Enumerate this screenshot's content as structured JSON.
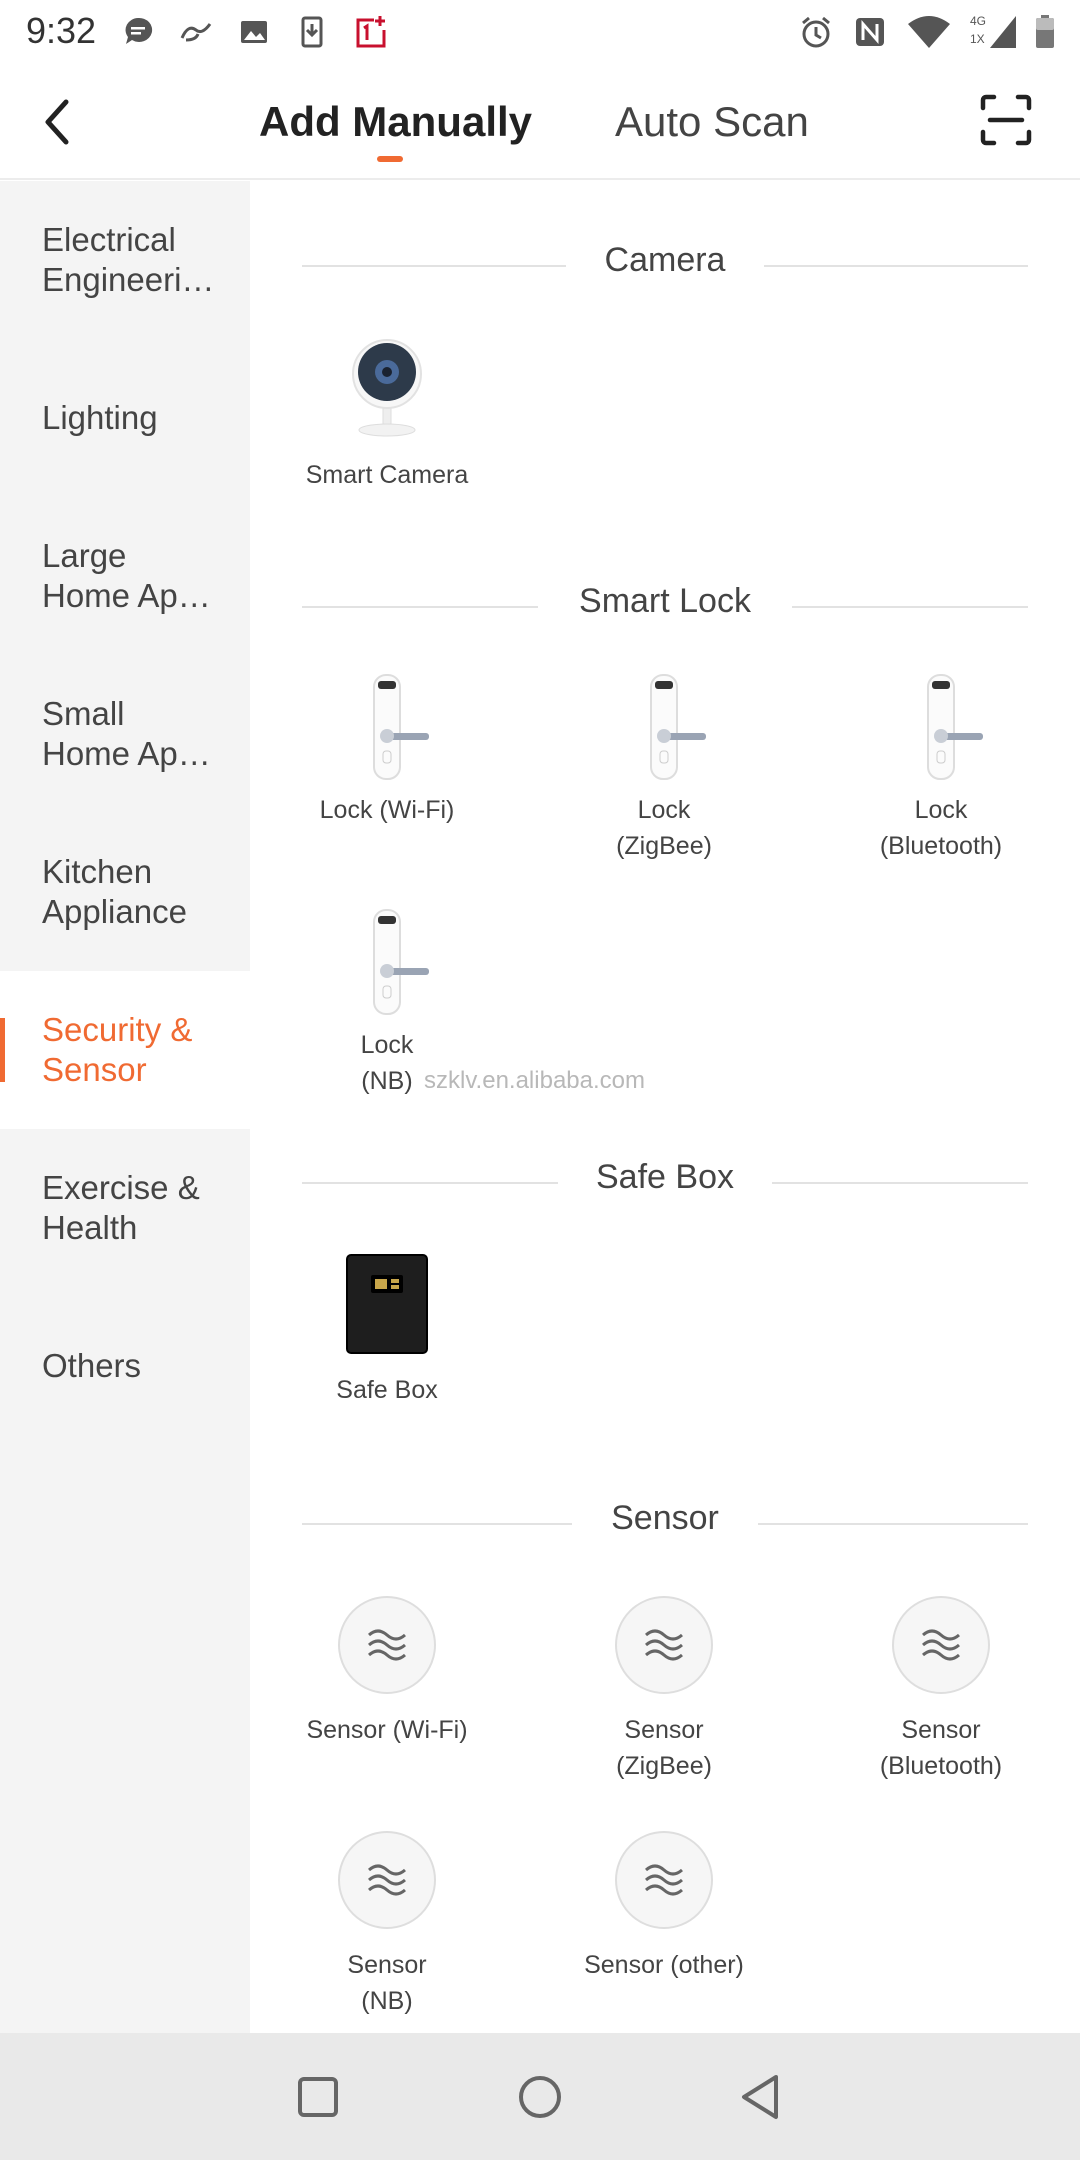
{
  "status_bar": {
    "time": "9:32",
    "left_icons": [
      "chat-icon",
      "alibaba-icon",
      "image-icon",
      "download-icon",
      "oneplus-icon"
    ],
    "right_icons": [
      "alarm-icon",
      "nfc-icon",
      "wifi-icon",
      "signal-icon",
      "battery-icon"
    ],
    "network_label": "4G",
    "network_sub": "1X"
  },
  "header": {
    "back_icon": "chevron-left-icon",
    "tabs": [
      {
        "label": "Add Manually",
        "active": true
      },
      {
        "label": "Auto Scan",
        "active": false
      }
    ],
    "scan_icon": "scan-icon",
    "accent_color": "#f06a32"
  },
  "sidebar": {
    "items": [
      {
        "label": "Electrical\nEngineeri…",
        "active": false
      },
      {
        "label": "Lighting",
        "active": false
      },
      {
        "label": "Large\nHome Ap…",
        "active": false
      },
      {
        "label": "Small\nHome Ap…",
        "active": false
      },
      {
        "label": "Kitchen\nAppliance",
        "active": false
      },
      {
        "label": "Security &\nSensor",
        "active": true
      },
      {
        "label": "Exercise &\nHealth",
        "active": false
      },
      {
        "label": "Others",
        "active": false
      }
    ]
  },
  "sections": [
    {
      "title": "Camera",
      "devices": [
        {
          "label": "Smart Camera",
          "icon": "camera-icon"
        }
      ]
    },
    {
      "title": "Smart Lock",
      "devices": [
        {
          "label": "Lock (Wi-Fi)",
          "icon": "lock-icon"
        },
        {
          "label": "Lock\n(ZigBee)",
          "icon": "lock-icon"
        },
        {
          "label": "Lock\n(Bluetooth)",
          "icon": "lock-icon"
        },
        {
          "label": "Lock\n(NB)",
          "icon": "lock-icon"
        }
      ]
    },
    {
      "title": "Safe Box",
      "devices": [
        {
          "label": "Safe Box",
          "icon": "safe-box-icon"
        }
      ]
    },
    {
      "title": "Sensor",
      "devices": [
        {
          "label": "Sensor (Wi-Fi)",
          "icon": "sensor-icon"
        },
        {
          "label": "Sensor\n(ZigBee)",
          "icon": "sensor-icon"
        },
        {
          "label": "Sensor\n(Bluetooth)",
          "icon": "sensor-icon"
        },
        {
          "label": "Sensor\n(NB)",
          "icon": "sensor-icon"
        },
        {
          "label": "Sensor (other)",
          "icon": "sensor-icon"
        }
      ]
    }
  ],
  "watermark": "szklv.en.alibaba.com",
  "nav_bar": {
    "icons": [
      "recents-icon",
      "home-icon",
      "back-icon"
    ]
  }
}
